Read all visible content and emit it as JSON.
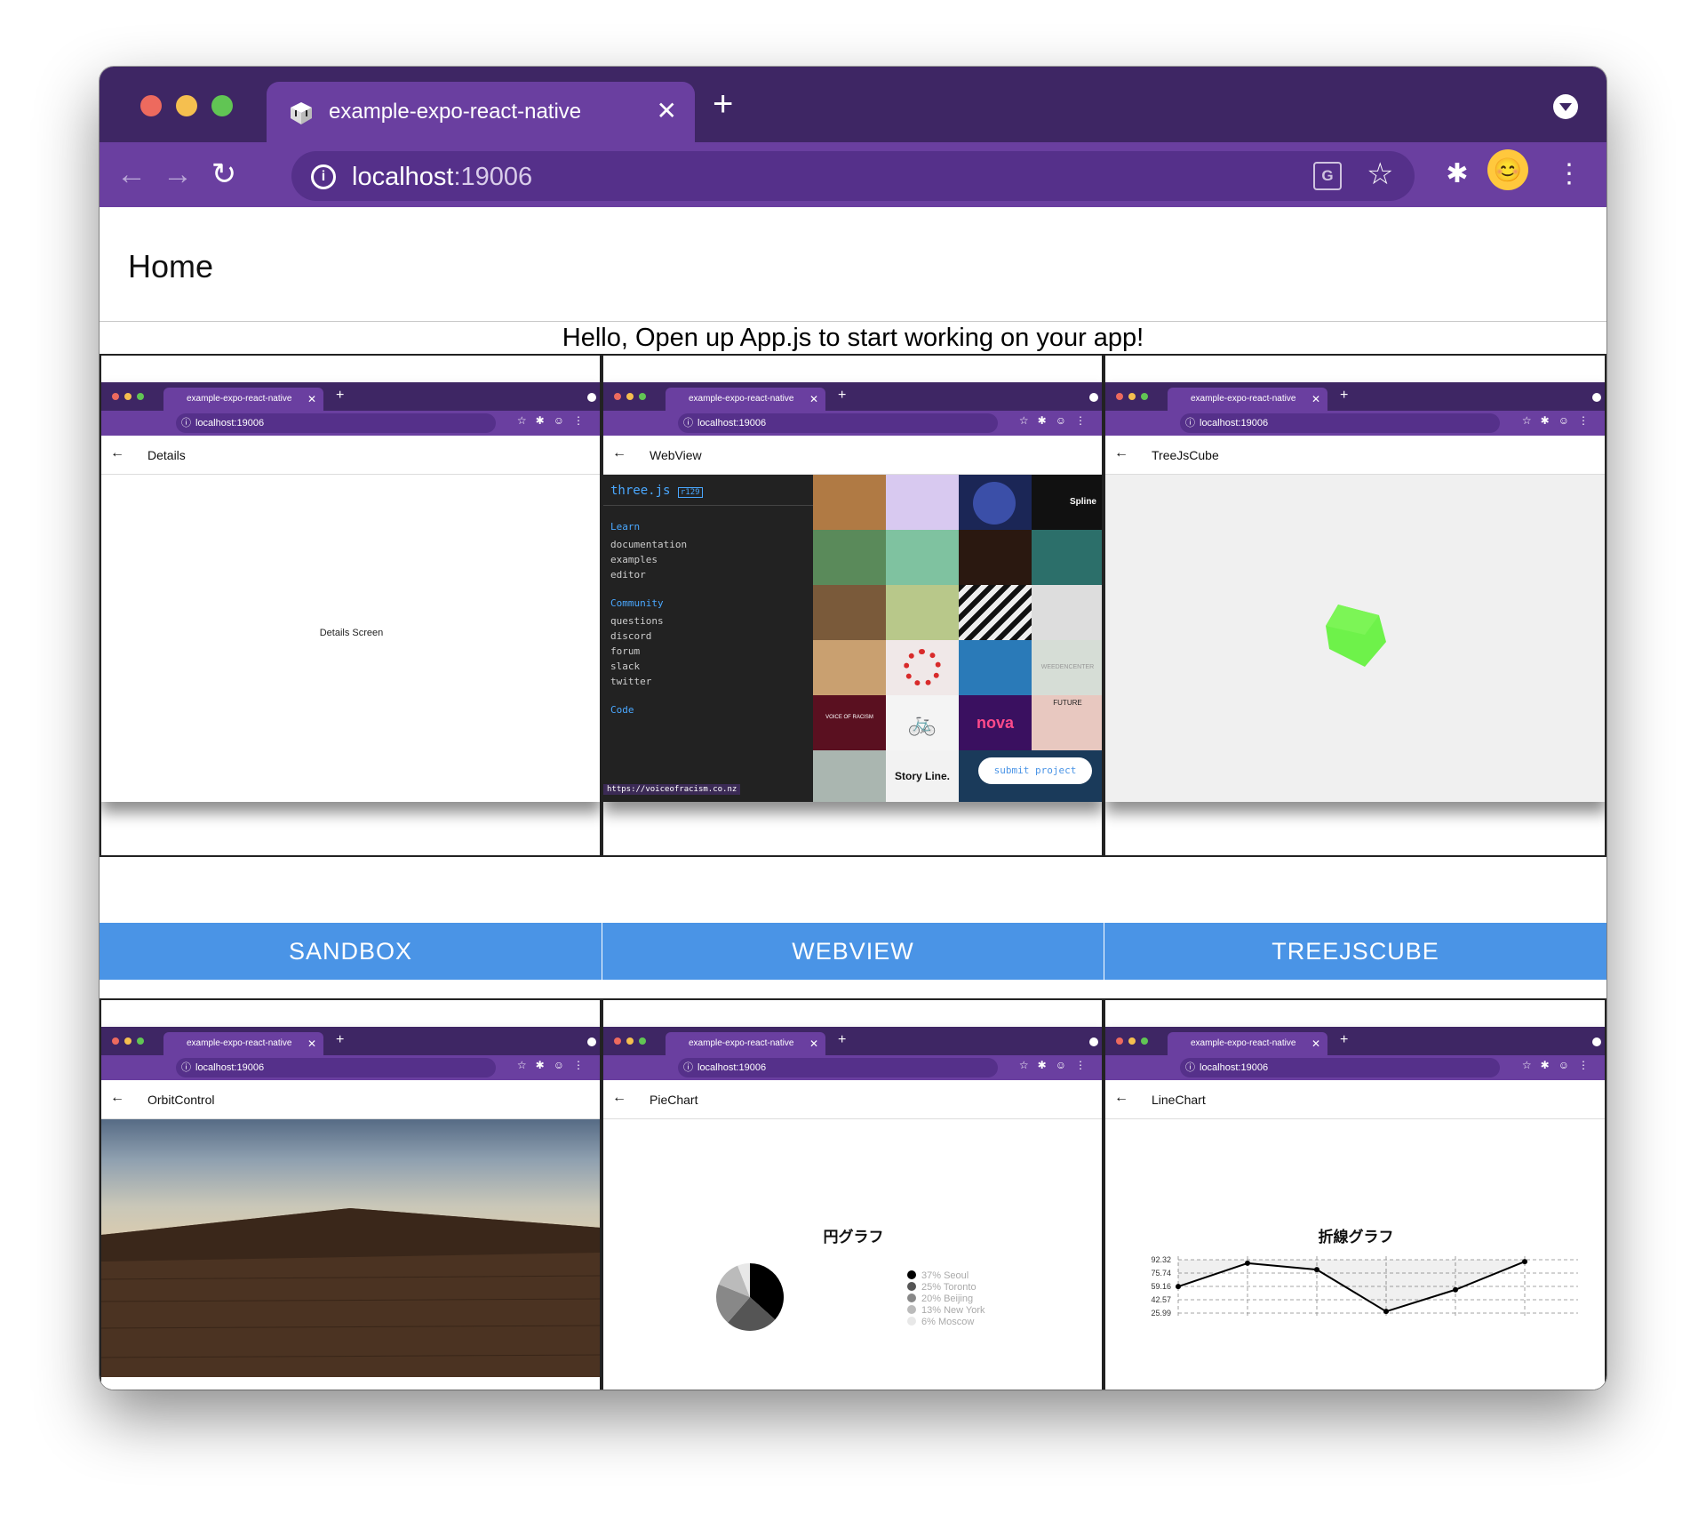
{
  "browser": {
    "tab_title": "example-expo-react-native",
    "tab_close": "✕",
    "new_tab": "+",
    "url_host": "localhost",
    "url_port": ":19006",
    "avatar": "😊",
    "colors": {
      "tabbar": "#3e2664",
      "toolbar": "#6a3fa0",
      "traffic_red": "#ed6a5e",
      "traffic_yellow": "#f5bf4f",
      "traffic_green": "#61c554"
    }
  },
  "header": {
    "title": "Home"
  },
  "hello_text": "Hello, Open up App.js to start working on your app!",
  "mini_browser": {
    "tab_title": "example-expo-react-native",
    "url": "localhost:19006",
    "close": "✕",
    "plus": "+"
  },
  "cards": [
    {
      "nav_title": "Details",
      "body_text": "Details Screen"
    },
    {
      "nav_title": "WebView"
    },
    {
      "nav_title": "TreeJsCube"
    },
    {
      "nav_title": "OrbitControl"
    },
    {
      "nav_title": "PieChart"
    },
    {
      "nav_title": "LineChart"
    }
  ],
  "webview": {
    "logo": "three.js",
    "version": "r129",
    "learn_heading": "Learn",
    "learn_items": [
      "documentation",
      "examples",
      "editor"
    ],
    "community_heading": "Community",
    "community_items": [
      "questions",
      "discord",
      "forum",
      "slack",
      "twitter"
    ],
    "code_heading": "Code",
    "status_url": "https://voiceofracism.co.nz",
    "submit_label": "submit project",
    "tile_labels": {
      "spline": "Spline",
      "nova": "nova",
      "future": "FUTURE",
      "voice": "VOICE OF RACISM",
      "story": "Story Line.",
      "weeden": "WEEDENCENTER"
    }
  },
  "buttons": {
    "sandbox": "SANDBOX",
    "webview": "WEBVIEW",
    "treejscube": "TREEJSCUBE"
  },
  "chart_data": [
    {
      "type": "pie",
      "title": "円グラフ",
      "categories": [
        "Seoul",
        "Toronto",
        "Beijing",
        "New York",
        "Moscow"
      ],
      "values": [
        37,
        25,
        20,
        13,
        6
      ],
      "legend": [
        "37% Seoul",
        "25% Toronto",
        "20% Beijing",
        "13% New York",
        "6% Moscow"
      ],
      "colors": [
        "#000000",
        "#555555",
        "#888888",
        "#bbbbbb",
        "#e8e8e8"
      ]
    },
    {
      "type": "line",
      "title": "折線グラフ",
      "y_ticks": [
        "92.32",
        "75.74",
        "59.16",
        "42.57",
        "25.99"
      ],
      "ylim": [
        25.99,
        92.32
      ],
      "values": [
        59,
        88,
        80,
        28,
        55,
        90
      ]
    }
  ]
}
